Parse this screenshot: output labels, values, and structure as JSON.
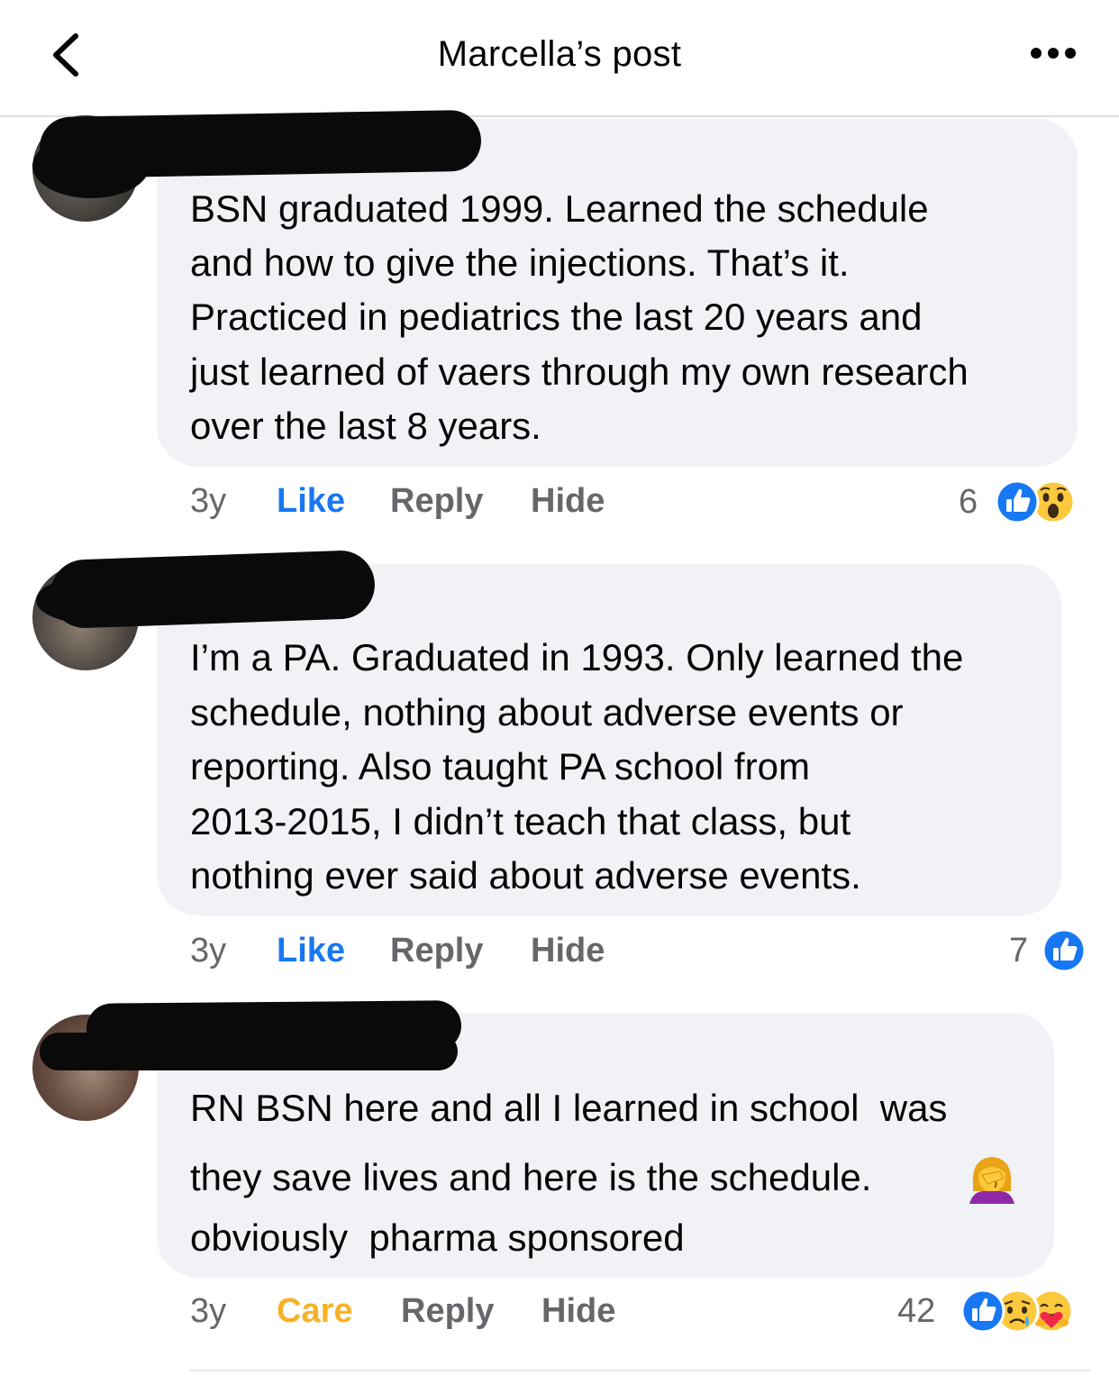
{
  "header": {
    "title": "Marcella’s post",
    "back_icon": "chevron-left-icon",
    "more_icon": "more-horizontal-icon"
  },
  "colors": {
    "like_blue": "#1877f2",
    "care_yellow": "#f7b125",
    "muted_gray": "#65676b",
    "bubble_bg": "#f0f2f5"
  },
  "comments": [
    {
      "lines": [
        "BSN graduated 1999. Learned the schedule",
        "and how to give the injections. That’s it.",
        "Practiced in pediatrics the last 20 years and",
        "just learned of vaers through my own research",
        "over the last 8 years."
      ],
      "time": "3y",
      "reaction_label": "Like",
      "reply_label": "Reply",
      "hide_label": "Hide",
      "reaction_count": "6",
      "reaction_icons": [
        "like-icon",
        "wow-icon"
      ]
    },
    {
      "lines": [
        "I’m a PA. Graduated in 1993. Only learned the",
        "schedule, nothing about adverse events or",
        "reporting. Also taught PA school from",
        "2013-2015, I didn’t teach that class, but",
        "nothing ever said about adverse events."
      ],
      "time": "3y",
      "reaction_label": "Like",
      "reply_label": "Reply",
      "hide_label": "Hide",
      "reaction_count": "7",
      "reaction_icons": [
        "like-icon"
      ]
    },
    {
      "lines": [
        "RN BSN here and all I learned in school  was",
        "they save lives and here is the schedule.",
        "obviously  pharma sponsored"
      ],
      "inline_emoji": "woman-facepalming-icon",
      "time": "3y",
      "reaction_label": "Care",
      "reply_label": "Reply",
      "hide_label": "Hide",
      "reaction_count": "42",
      "reaction_icons": [
        "like-icon",
        "sad-icon",
        "care-icon"
      ]
    }
  ]
}
